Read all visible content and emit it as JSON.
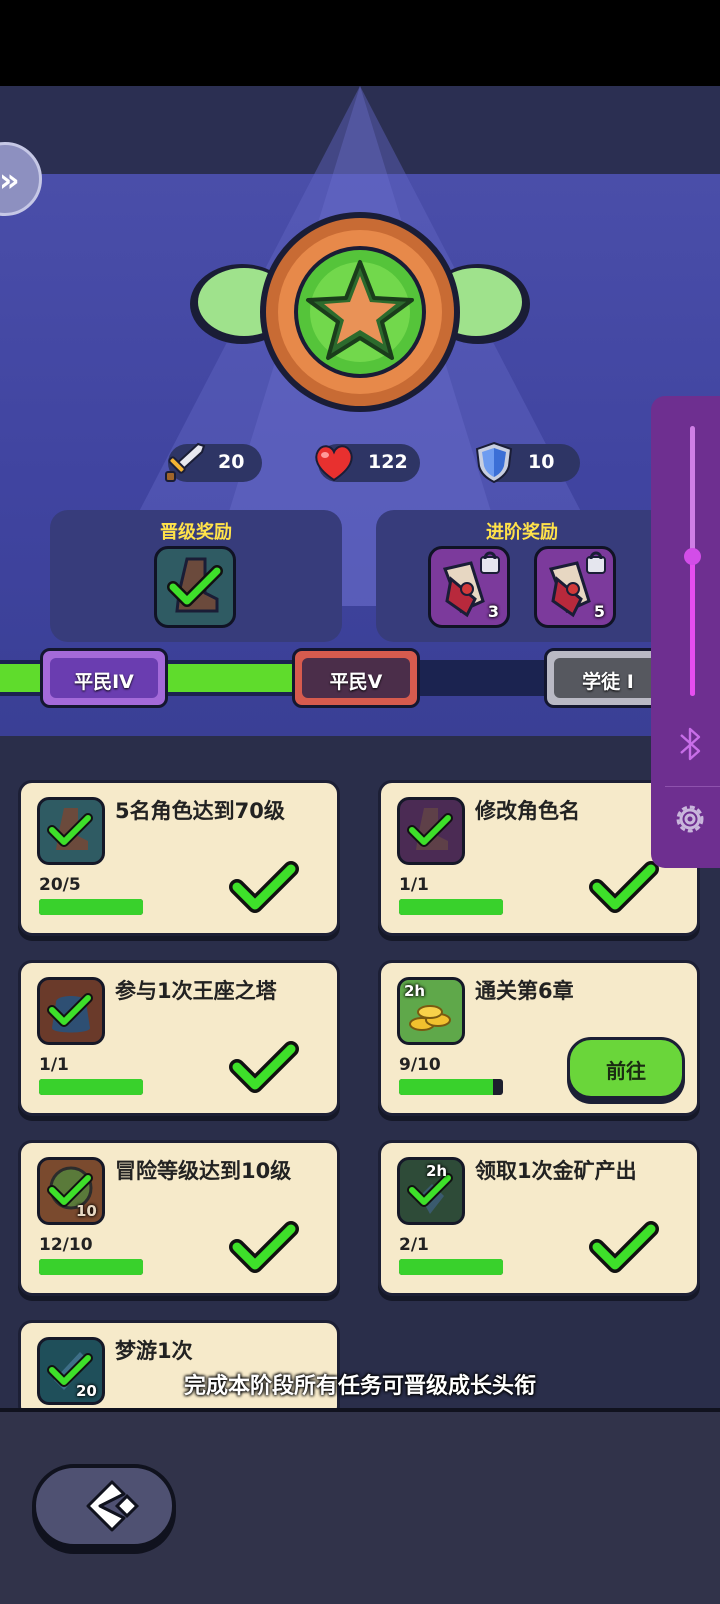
{
  "hero": {
    "stats": [
      {
        "icon": "sword-icon",
        "value": "20"
      },
      {
        "icon": "heart-icon",
        "value": "122"
      },
      {
        "icon": "shield-icon",
        "value": "10"
      }
    ],
    "promotion_reward": {
      "title": "晋级奖励"
    },
    "advance_reward": {
      "title": "进阶奖励",
      "counts": [
        "3",
        "5"
      ]
    }
  },
  "ranks": [
    {
      "label": "平民IV",
      "state": "completed"
    },
    {
      "label": "平民V",
      "state": "current"
    },
    {
      "label": "学徒 I",
      "state": "locked"
    }
  ],
  "progress_track": {
    "fill": 0.58
  },
  "tasks": [
    {
      "name": "5名角色达到70级",
      "progress": "20/5",
      "fill": 1.0,
      "done": true,
      "icon": "boot-icon"
    },
    {
      "name": "修改角色名",
      "progress": "1/1",
      "fill": 1.0,
      "done": true,
      "icon": "boot-icon"
    },
    {
      "name": "参与1次王座之塔",
      "progress": "1/1",
      "fill": 1.0,
      "done": true,
      "icon": "bag-icon"
    },
    {
      "name": "通关第6章",
      "progress": "9/10",
      "fill": 0.9,
      "done": false,
      "icon": "gold-coins-icon",
      "timer": "2h",
      "button": "前往"
    },
    {
      "name": "冒险等级达到10级",
      "progress": "12/10",
      "fill": 1.0,
      "done": true,
      "icon": "level-icon",
      "level": "10"
    },
    {
      "name": "领取1次金矿产出",
      "progress": "2/1",
      "fill": 1.0,
      "done": true,
      "icon": "pickaxe-icon",
      "timer": "2h"
    },
    {
      "name": "梦游1次",
      "icon": "scroll-icon",
      "level": "20"
    }
  ],
  "tip": "完成本阶段所有任务可晋级成长头衔",
  "colors": {
    "accent_green": "#39d12c",
    "card": "#f6eaca",
    "panel": "#373c7b"
  }
}
